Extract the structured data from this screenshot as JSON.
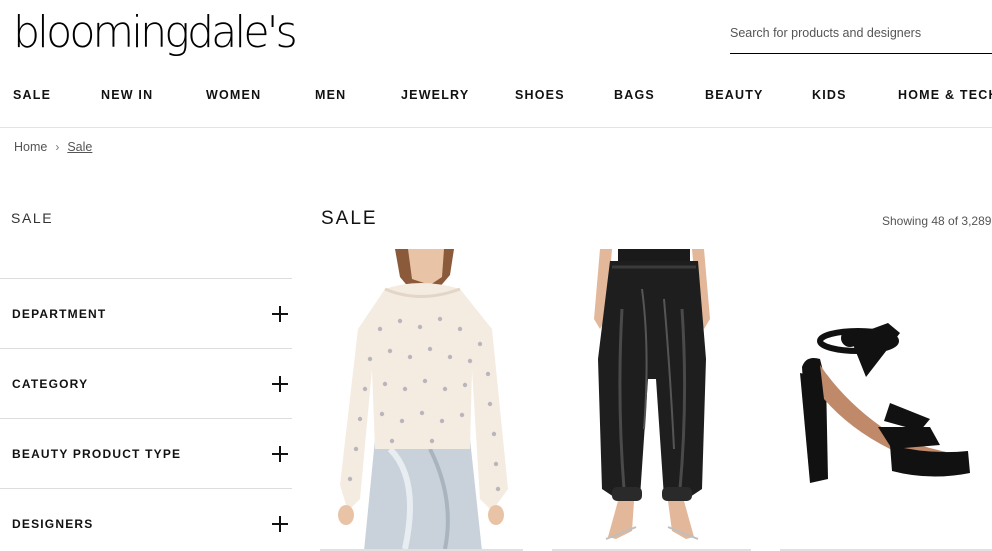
{
  "header": {
    "logo": "bloomingdale's",
    "search_placeholder": "Search for products and designers"
  },
  "nav": {
    "items": [
      "SALE",
      "NEW IN",
      "WOMEN",
      "MEN",
      "JEWELRY",
      "SHOES",
      "BAGS",
      "BEAUTY",
      "KIDS",
      "HOME & TECH"
    ]
  },
  "breadcrumb": {
    "home": "Home",
    "separator": "›",
    "current": "Sale"
  },
  "sidebar": {
    "title": "SALE",
    "facets": [
      "DEPARTMENT",
      "CATEGORY",
      "BEAUTY PRODUCT TYPE",
      "DESIGNERS"
    ]
  },
  "main": {
    "title": "SALE",
    "showing": "Showing 48 of 3,289"
  },
  "products": [
    {
      "image": "cream-embellished-sweater"
    },
    {
      "image": "black-leather-jogger-pants"
    },
    {
      "image": "black-suede-platform-sandal"
    }
  ]
}
